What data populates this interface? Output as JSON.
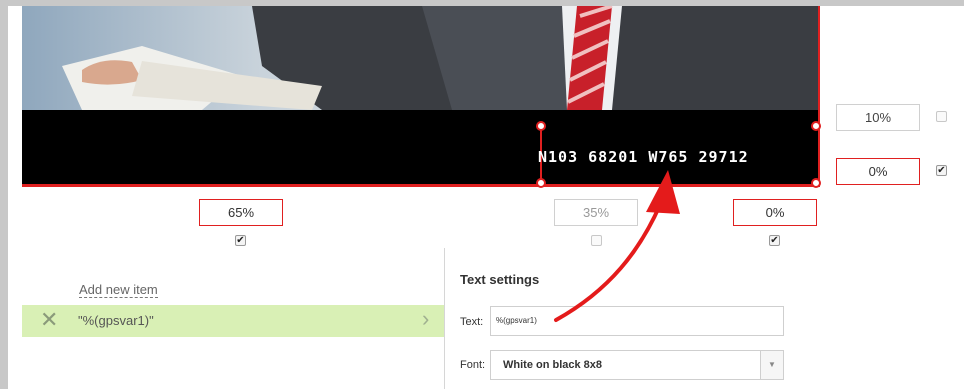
{
  "preview": {
    "overlay_text": "N103 68201 W765 29712"
  },
  "margins": {
    "right_top": "10%",
    "right_bottom": "0%",
    "bottom_left": "65%",
    "bottom_mid": "35%",
    "bottom_right": "0%"
  },
  "checkboxes": {
    "right_top": false,
    "right_bottom": true,
    "bottom_left": true,
    "bottom_mid": false,
    "bottom_right": true
  },
  "item_list": {
    "add_new_label": "Add new item",
    "items": [
      {
        "label": "\"%(gpsvar1)\""
      }
    ]
  },
  "text_settings": {
    "title": "Text settings",
    "text_label": "Text:",
    "text_value": "%(gpsvar1)",
    "font_label": "Font:",
    "font_value": "White on black 8x8"
  },
  "colors": {
    "accent_red": "#e02020",
    "selected_item_bg": "#d9f0b5"
  }
}
